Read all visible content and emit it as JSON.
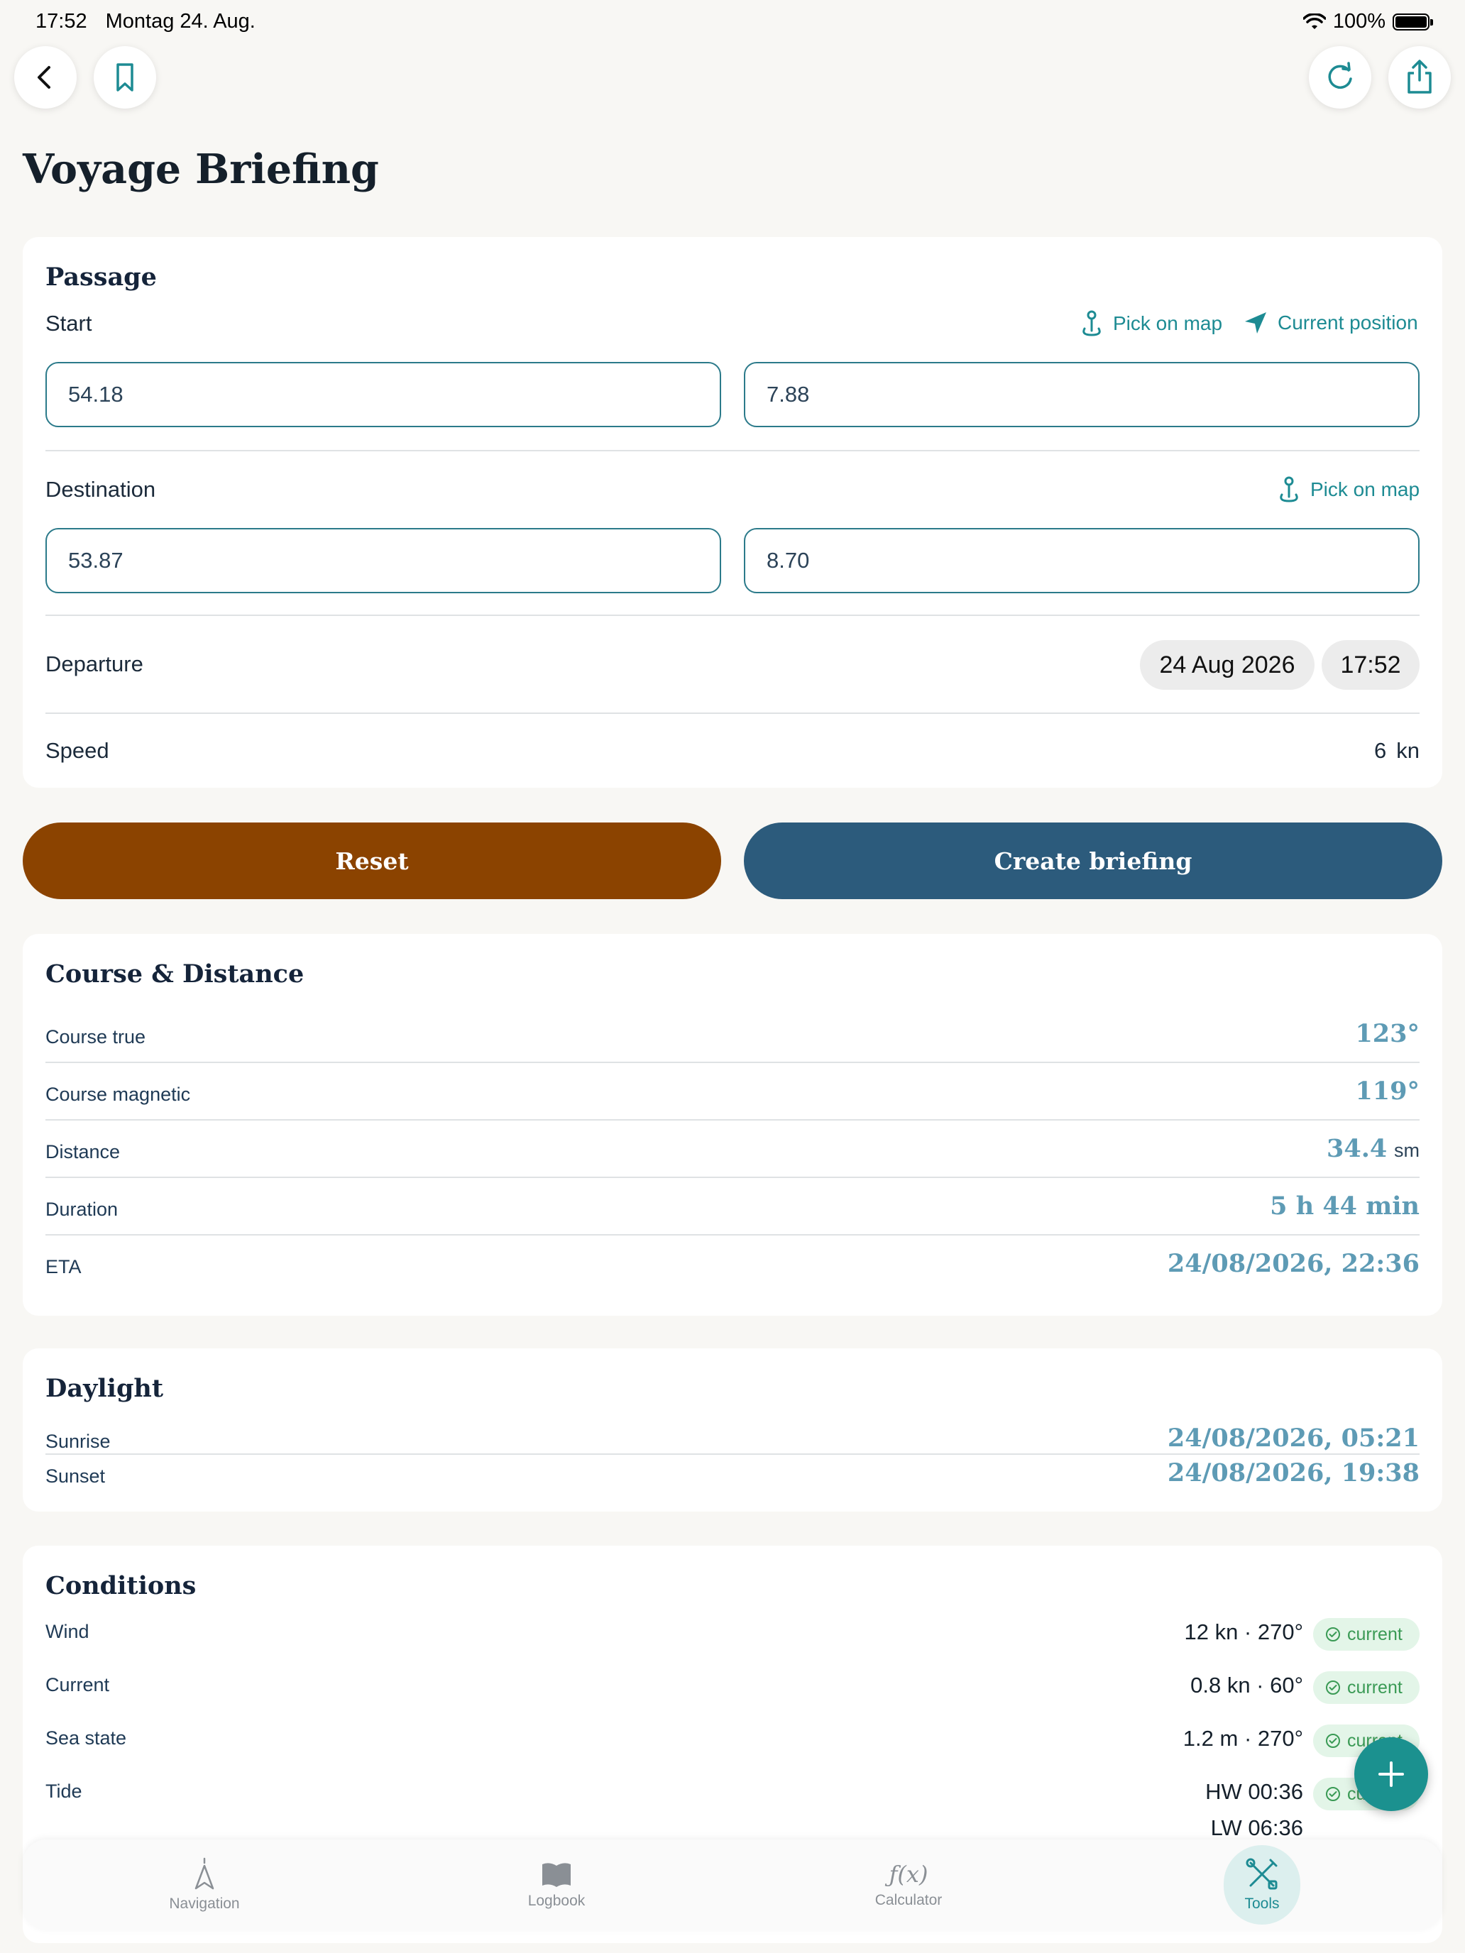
{
  "status": {
    "time": "17:52",
    "date": "Montag 24. Aug.",
    "battery": "100%"
  },
  "title": "Voyage Briefing",
  "passage": {
    "title": "Passage",
    "start_label": "Start",
    "pick_on_map": "Pick on map",
    "current_position": "Current position",
    "start_lat": "54.18",
    "start_lon": "7.88",
    "destination_label": "Destination",
    "dest_lat": "53.87",
    "dest_lon": "8.70",
    "departure_label": "Departure",
    "departure_date": "24 Aug 2026",
    "departure_time": "17:52",
    "speed_label": "Speed",
    "speed_value": "6",
    "speed_unit": "kn"
  },
  "actions": {
    "reset": "Reset",
    "create": "Create briefing"
  },
  "course": {
    "title": "Course & Distance",
    "rows": [
      {
        "label": "Course true",
        "value": "123°",
        "unit": ""
      },
      {
        "label": "Course magnetic",
        "value": "119°",
        "unit": ""
      },
      {
        "label": "Distance",
        "value": "34.4",
        "unit": "sm"
      },
      {
        "label": "Duration",
        "value": "5 h 44 min",
        "unit": ""
      },
      {
        "label": "ETA",
        "value": "24/08/2026, 22:36",
        "unit": ""
      }
    ]
  },
  "daylight": {
    "title": "Daylight",
    "sunrise_label": "Sunrise",
    "sunrise_value": "24/08/2026, 05:21",
    "sunset_label": "Sunset",
    "sunset_value": "24/08/2026, 19:38"
  },
  "conditions": {
    "title": "Conditions",
    "badge": "current",
    "rows": [
      {
        "label": "Wind",
        "value": "12 kn · 270°"
      },
      {
        "label": "Current",
        "value": "0.8 kn · 60°"
      },
      {
        "label": "Sea state",
        "value": "1.2 m · 270°"
      },
      {
        "label": "Tide",
        "value": "HW 00:36",
        "value2": "LW 06:36"
      }
    ]
  },
  "tabs": [
    {
      "label": "Navigation"
    },
    {
      "label": "Logbook"
    },
    {
      "label": "Calculator",
      "icon_text": "ƒ(x)"
    },
    {
      "label": "Tools"
    }
  ],
  "colors": {
    "accent": "#1d8b93",
    "reset": "#8b4300",
    "create": "#2c5b7c",
    "value": "#5e9bb5"
  }
}
